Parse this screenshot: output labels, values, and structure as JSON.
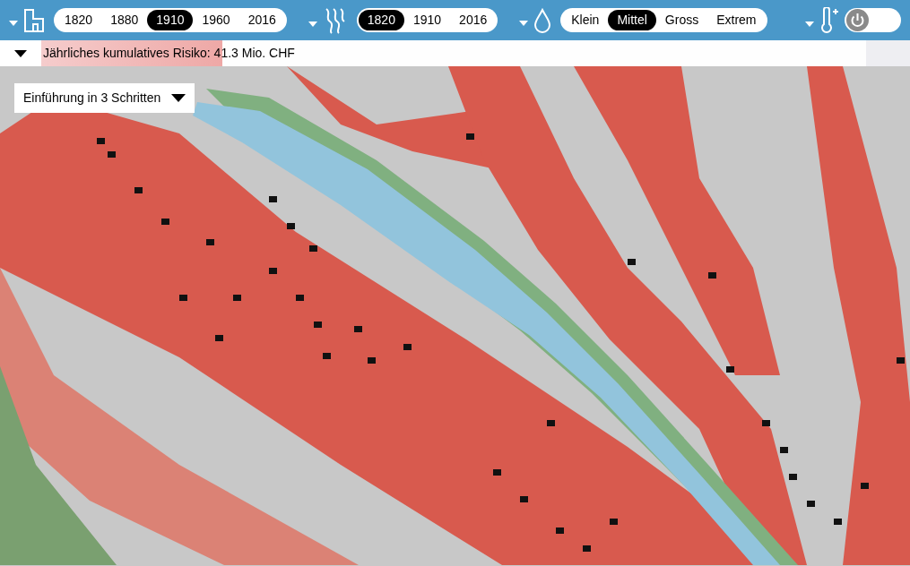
{
  "toolbar": {
    "groups": [
      {
        "kind": "buildings",
        "options": [
          {
            "label": "1820",
            "selected": false
          },
          {
            "label": "1880",
            "selected": false
          },
          {
            "label": "1910",
            "selected": true
          },
          {
            "label": "1960",
            "selected": false
          },
          {
            "label": "2016",
            "selected": false
          }
        ]
      },
      {
        "kind": "flood",
        "options": [
          {
            "label": "1820",
            "selected": true
          },
          {
            "label": "1910",
            "selected": false
          },
          {
            "label": "2016",
            "selected": false
          }
        ]
      },
      {
        "kind": "rain",
        "options": [
          {
            "label": "Klein",
            "selected": false
          },
          {
            "label": "Mittel",
            "selected": true
          },
          {
            "label": "Gross",
            "selected": false
          },
          {
            "label": "Extrem",
            "selected": false
          }
        ]
      }
    ],
    "climate_toggle": {
      "on": false
    }
  },
  "risk_bar": {
    "label": "Jährliches kumulatives Risiko",
    "value": ": 41.3 Mio. CHF",
    "level": 0.22
  },
  "intro_dropdown": {
    "label": "Einführung in 3 Schritten"
  }
}
